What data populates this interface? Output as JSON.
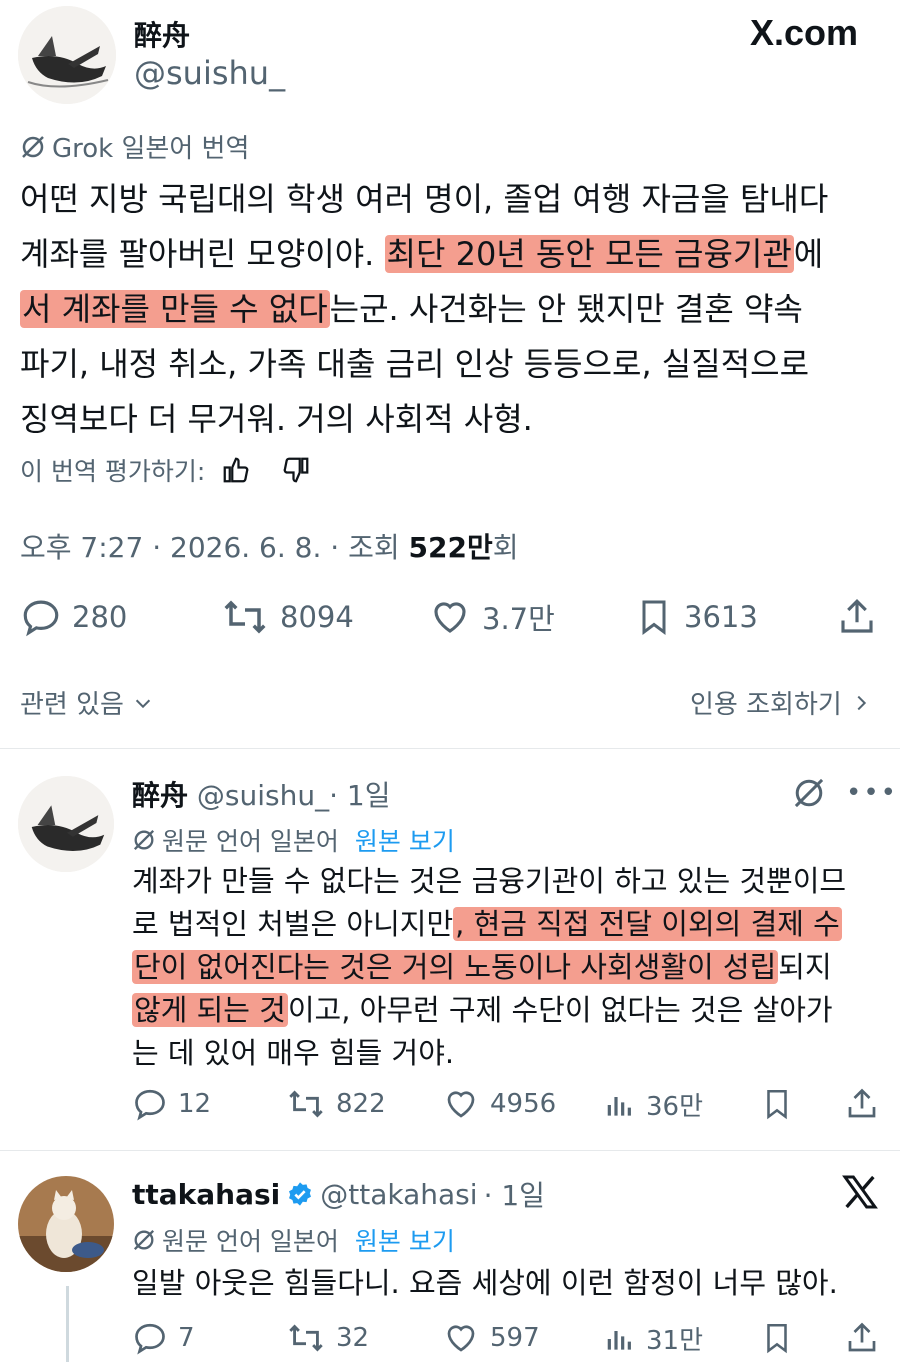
{
  "header": {
    "display_name": "醉舟",
    "handle": "@suishu_",
    "site_logo": "X.com"
  },
  "main_post": {
    "translation_label": "Grok 일본어 번역",
    "text_1": "어떤 지방 국립대의 학생 여러 명이, 졸업 여행 자금을 탐내다",
    "text_2a": "계좌를 팔아버린 모양이야. ",
    "text_2b_hl": "최단 20년 동안 모든 금융기관",
    "text_2c": "에",
    "text_3a_hl": "서 계좌를 만들 수 없다",
    "text_3b": "는군. 사건화는 안 됐지만 결혼 약속",
    "text_4": "파기, 내정 취소, 가족 대출 금리 인상 등등으로, 실질적으로",
    "text_5": "징역보다 더 무거워. 거의 사회적 사형.",
    "rate_label": "이 번역 평가하기:",
    "time": "오후 7:27 · 2026. 6. 8. · 조회 ",
    "views_num": "522만",
    "views_suffix": "회",
    "stats": {
      "replies": "280",
      "reposts": "8094",
      "likes": "3.7만",
      "bookmarks": "3613"
    },
    "related_label": "관련 있음",
    "quotes_label": "인용 조회하기"
  },
  "reply1": {
    "name": "醉舟",
    "handle": "@suishu_",
    "time": "· 1일",
    "lang_label": "원문 언어 일본어",
    "view_original": "원본 보기",
    "line_1": "계좌가 만들 수 없다는 것은 금융기관이 하고 있는 것뿐이므",
    "line_2a": "로 법적인 처벌은 아니지만",
    "line_2b_hl": ", 현금 직접 전달 이외의 결제 수",
    "line_3a_hl": "단이 없어진다는 것은 거의 노동이나 사회생활이 성립",
    "line_3b": "되지",
    "line_4a_hl": "않게 되는 것",
    "line_4b": "이고, 아무런 구제 수단이 없다는 것은 살아가",
    "line_5": "는 데 있어 매우 힘들 거야.",
    "stats": {
      "replies": "12",
      "reposts": "822",
      "likes": "4956",
      "views": "36만"
    }
  },
  "reply2": {
    "name": "ttakahasi",
    "handle": "@ttakahasi",
    "time": "· 1일",
    "lang_label": "원문 언어 일본어",
    "view_original": "원본 보기",
    "text": "일발 아웃은 힘들다니. 요즘 세상에 이런 함정이 너무 많아.",
    "stats": {
      "replies": "7",
      "reposts": "32",
      "likes": "597",
      "views": "31만"
    }
  },
  "colors": {
    "link": "#1d9bf0",
    "highlight": "#f07864",
    "verified": "#1d9bf0",
    "muted": "#536471"
  }
}
